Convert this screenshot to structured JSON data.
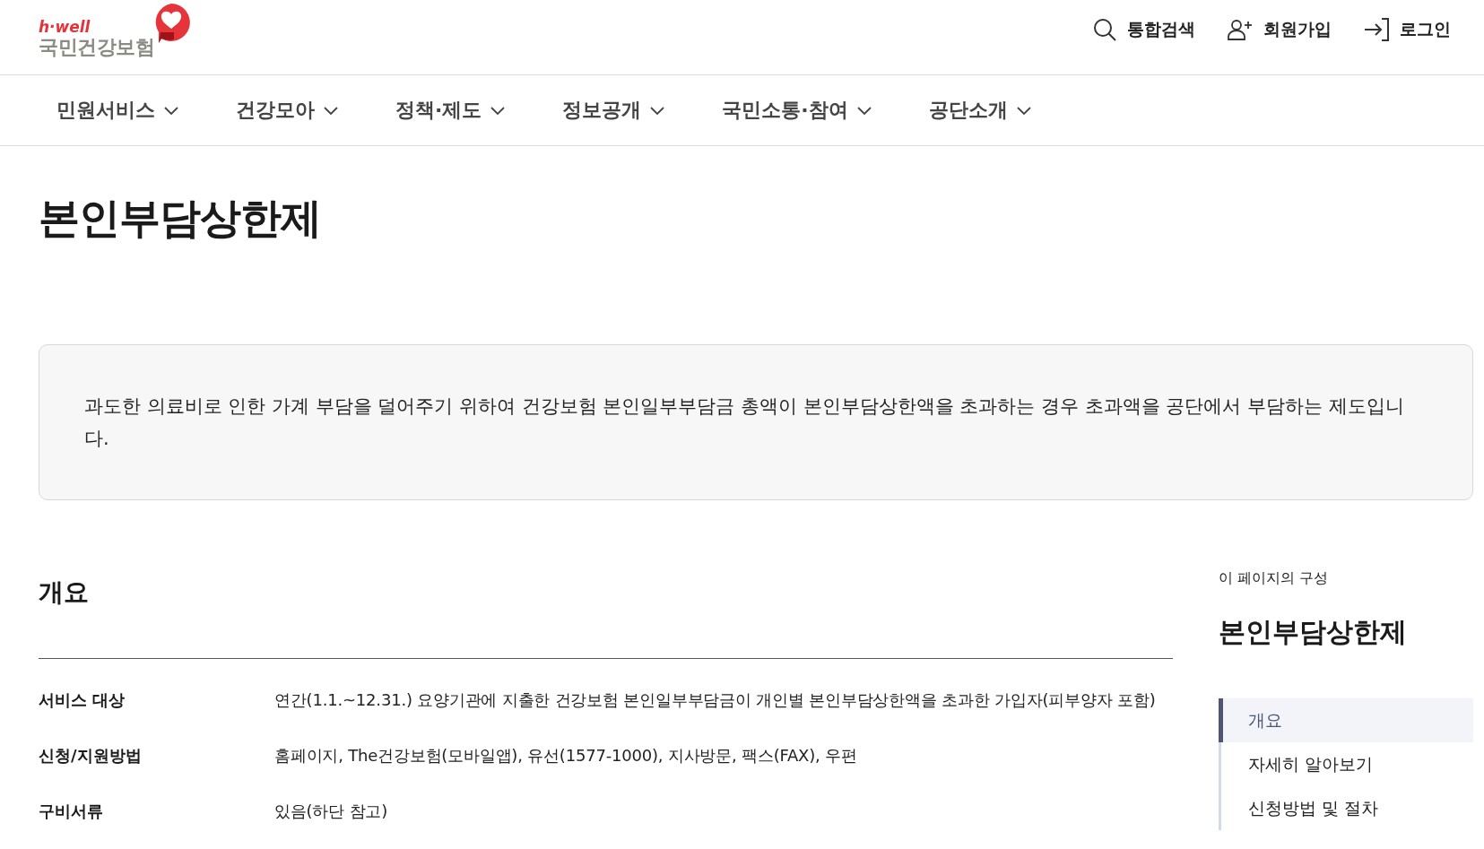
{
  "header": {
    "logo": {
      "tagline": "h·well",
      "name": "국민건강보험"
    },
    "utility_links": [
      {
        "kind": "search",
        "label": "통합검색"
      },
      {
        "kind": "signup",
        "label": "회원가입"
      },
      {
        "kind": "login",
        "label": "로그인"
      }
    ]
  },
  "nav": {
    "items": [
      {
        "label": "민원서비스"
      },
      {
        "label": "건강모아"
      },
      {
        "label": "정책·제도"
      },
      {
        "label": "정보공개"
      },
      {
        "label": "국민소통·참여"
      },
      {
        "label": "공단소개"
      }
    ]
  },
  "page_title": "본인부담상한제",
  "summary": "과도한 의료비로 인한 가계 부담을 덜어주기 위하여 건강보험 본인일부부담금 총액이 본인부담상한액을 초과하는 경우 초과액을 공단에서 부담하는 제도입니다.",
  "section": {
    "title": "개요",
    "rows": [
      {
        "label": "서비스 대상",
        "value": "연간(1.1.~12.31.) 요양기관에 지출한 건강보험 본인일부부담금이 개인별 본인부담상한액을 초과한 가입자(피부양자 포함)"
      },
      {
        "label": "신청/지원방법",
        "value": "홈페이지, The건강보험(모바일앱), 유선(1577-1000), 지사방문, 팩스(FAX), 우편"
      },
      {
        "label": "구비서류",
        "value": "있음(하단 참고)"
      }
    ]
  },
  "toc": {
    "caption": "이 페이지의 구성",
    "title": "본인부담상한제",
    "items": [
      {
        "label": "개요",
        "selected": true
      },
      {
        "label": "자세히 알아보기",
        "selected": false
      },
      {
        "label": "신청방법 및 절차",
        "selected": false
      }
    ]
  }
}
